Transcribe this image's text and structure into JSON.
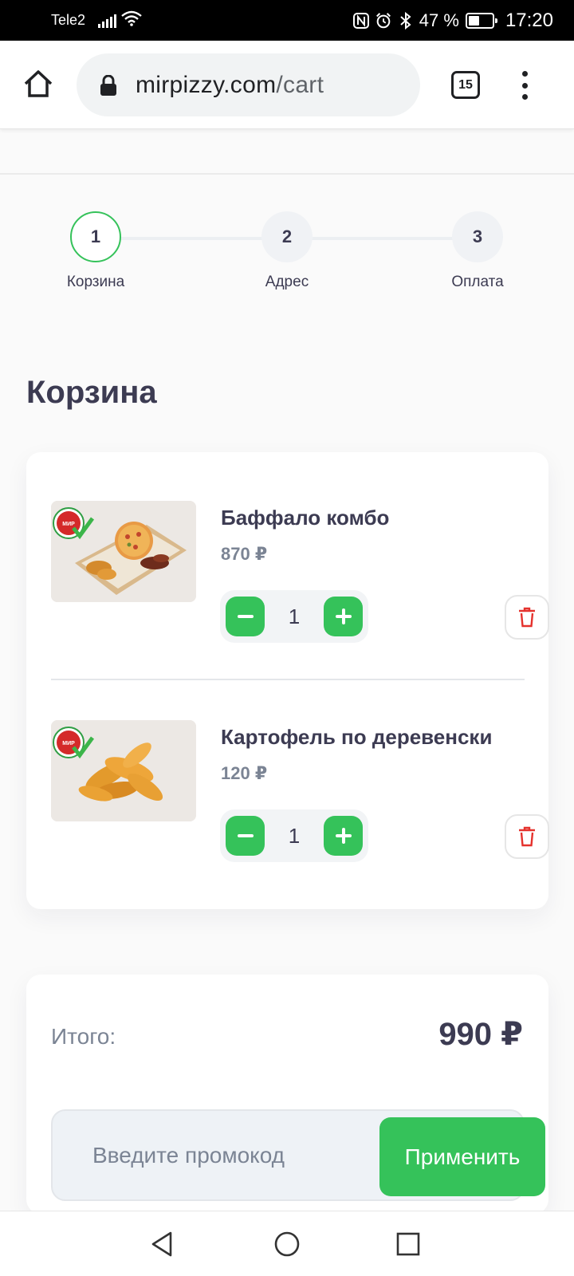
{
  "status_bar": {
    "carrier": "Tele2",
    "battery": "47 %",
    "battery_level": 0.47,
    "time": "17:20"
  },
  "browser": {
    "url_domain": "mirpizzy.com",
    "url_path": "/cart",
    "tab_count": "15"
  },
  "steps": [
    {
      "number": "1",
      "label": "Корзина",
      "active": true
    },
    {
      "number": "2",
      "label": "Адрес",
      "active": false
    },
    {
      "number": "3",
      "label": "Оплата",
      "active": false
    }
  ],
  "page_title": "Корзина",
  "cart": {
    "items": [
      {
        "name": "Баффало комбо",
        "price": "870 ₽",
        "quantity": "1",
        "image": "pizza-combo-image"
      },
      {
        "name": "Картофель по деревенски",
        "price": "120 ₽",
        "quantity": "1",
        "image": "potato-wedges-image"
      }
    ]
  },
  "summary": {
    "total_label": "Итого:",
    "total_value": "990 ₽",
    "promo_placeholder": "Введите промокод",
    "apply_label": "Применить"
  },
  "colors": {
    "accent_green": "#35c25a",
    "text_dark": "#3c3b52",
    "text_muted": "#7b8494",
    "delete_red": "#e5322d"
  }
}
